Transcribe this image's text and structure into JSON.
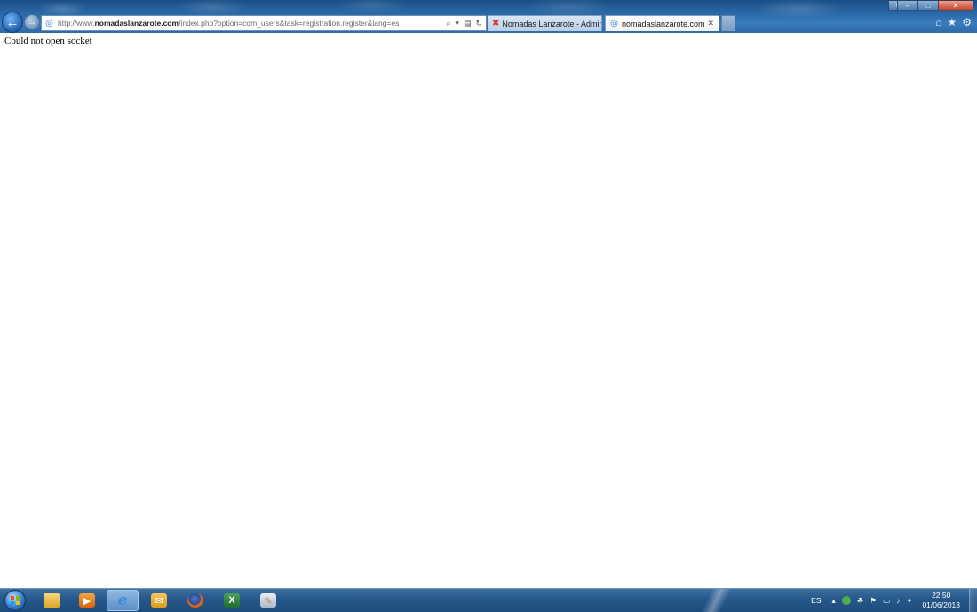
{
  "browser": {
    "address": {
      "prefix": "http://www.",
      "domain": "nomadaslanzarote.com",
      "path": "/index.php?option=com_users&task=registration.register&lang=es"
    },
    "tabs": [
      {
        "label": "Nomadas Lanzarote - Adminis...",
        "favicon": "joomla-icon",
        "active": false
      },
      {
        "label": "nomadaslanzarote.com",
        "favicon": "ie-page-icon",
        "active": true
      }
    ]
  },
  "page": {
    "message": "Could not open socket"
  },
  "taskbar": {
    "apps": [
      {
        "icon": "folder-icon"
      },
      {
        "icon": "media-player-icon"
      },
      {
        "icon": "internet-explorer-icon",
        "active": true
      },
      {
        "icon": "outlook-icon"
      },
      {
        "icon": "firefox-icon"
      },
      {
        "icon": "excel-icon"
      },
      {
        "icon": "paint-icon"
      }
    ],
    "tray": {
      "language": "ES",
      "time": "22:50",
      "date": "01/06/2013"
    }
  },
  "colors": {
    "chrome_blue": "#2b6bab",
    "taskbar_blue": "#28598c",
    "page_background": "#ffffff"
  }
}
